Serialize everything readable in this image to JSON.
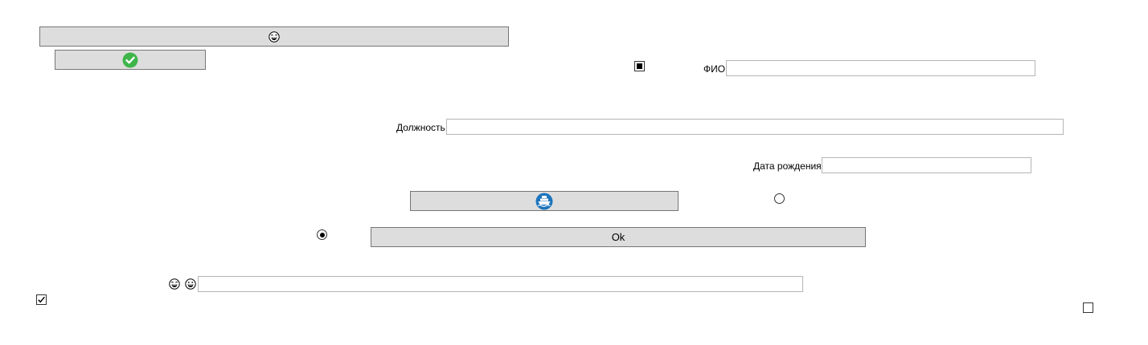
{
  "buttons": {
    "emoji_button": {
      "icon": "laughing-face-icon"
    },
    "confirm_button": {
      "icon": "green-checkmark-icon"
    },
    "ship_button": {
      "icon": "ship-icon"
    },
    "ok_button": {
      "label": "Ok"
    }
  },
  "fields": {
    "fio": {
      "label": "ФИО",
      "value": ""
    },
    "position": {
      "label": "Должность",
      "value": ""
    },
    "birth_date": {
      "label": "Дата рождения",
      "value": ""
    },
    "emoji_field": {
      "prefix_icons": [
        "laughing-face-icon",
        "grinning-face-icon"
      ],
      "value": ""
    }
  },
  "controls": {
    "filled_checkbox": {
      "state": "indeterminate"
    },
    "radio_top": {
      "state": "unchecked"
    },
    "radio_left": {
      "state": "checked"
    },
    "checkbox_checked": {
      "state": "checked"
    },
    "checkbox_empty": {
      "state": "unchecked"
    }
  },
  "colors": {
    "button_bg": "#dddddd",
    "button_border": "#767676",
    "check_green": "#3fb549",
    "ship_blue": "#1c75bc"
  }
}
